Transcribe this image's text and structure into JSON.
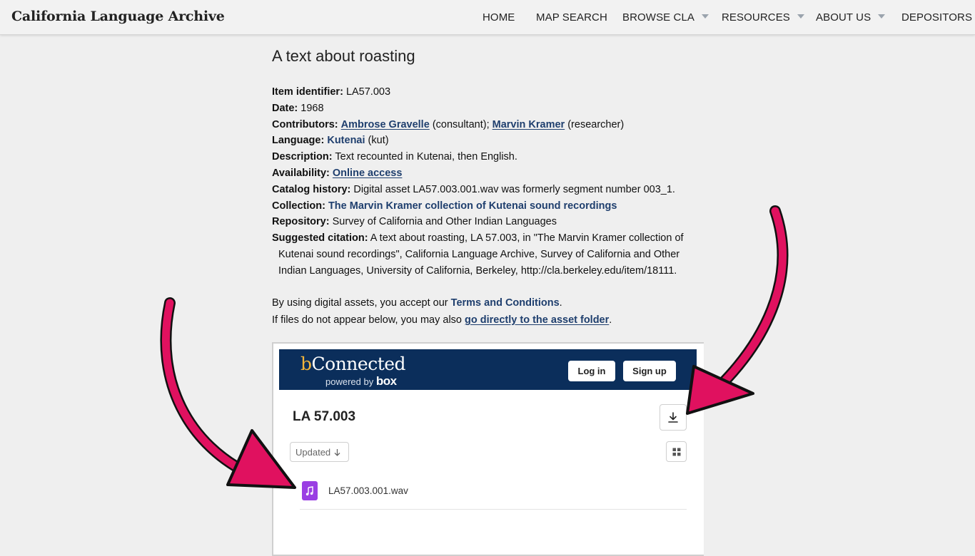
{
  "header": {
    "site_title": "California Language Archive",
    "nav": [
      {
        "label": "HOME",
        "has_dropdown": false
      },
      {
        "label": "MAP SEARCH",
        "has_dropdown": false
      },
      {
        "label": "BROWSE CLA",
        "has_dropdown": true
      },
      {
        "label": "RESOURCES",
        "has_dropdown": true
      },
      {
        "label": "ABOUT US",
        "has_dropdown": true
      },
      {
        "label": "DEPOSITORS",
        "has_dropdown": false
      }
    ]
  },
  "item": {
    "title": "A text about roasting",
    "identifier_label": "Item identifier:",
    "identifier": "LA57.003",
    "date_label": "Date:",
    "date": "1968",
    "contributors_label": "Contributors:",
    "contributor1_name": "Ambrose Gravelle",
    "contributor1_role": "(consultant);",
    "contributor2_name": "Marvin Kramer",
    "contributor2_role": "(researcher)",
    "language_label": "Language:",
    "language_name": "Kutenai",
    "language_code": "(kut)",
    "description_label": "Description:",
    "description": "Text recounted in Kutenai, then English.",
    "availability_label": "Availability:",
    "availability": "Online access",
    "catalog_label": "Catalog history:",
    "catalog": "Digital asset LA57.003.001.wav was formerly segment number 003_1.",
    "collection_label": "Collection:",
    "collection": "The Marvin Kramer collection of Kutenai sound recordings",
    "repository_label": "Repository:",
    "repository": "Survey of California and Other Indian Languages",
    "citation_label": "Suggested citation:",
    "citation_line1": "A text about roasting, LA 57.003, in \"The Marvin Kramer collection of",
    "citation_line2": "Kutenai sound recordings\", California Language Archive, Survey of California and Other",
    "citation_line3": "Indian Languages, University of California, Berkeley, http://cla.berkeley.edu/item/18111."
  },
  "notes": {
    "terms_prefix": "By using digital assets, you accept our ",
    "terms_link": "Terms and Conditions",
    "terms_suffix": ".",
    "folder_prefix": "If files do not appear below, you may also ",
    "folder_link": "go directly to the asset folder",
    "folder_suffix": "."
  },
  "box_embed": {
    "logo_b": "b",
    "logo_rest": "Connected",
    "powered_by": "powered by",
    "box_word": "box",
    "login_label": "Log in",
    "signup_label": "Sign up",
    "folder_title": "LA 57.003",
    "sort_label": "Updated",
    "files": [
      {
        "name": "LA57.003.001.wav",
        "icon": "audio-file-icon"
      }
    ],
    "colors": {
      "header_bg": "#0b2e5b",
      "file_icon": "#9a3fe3"
    }
  },
  "annotations": {
    "arrow_color": "#e0115f"
  }
}
